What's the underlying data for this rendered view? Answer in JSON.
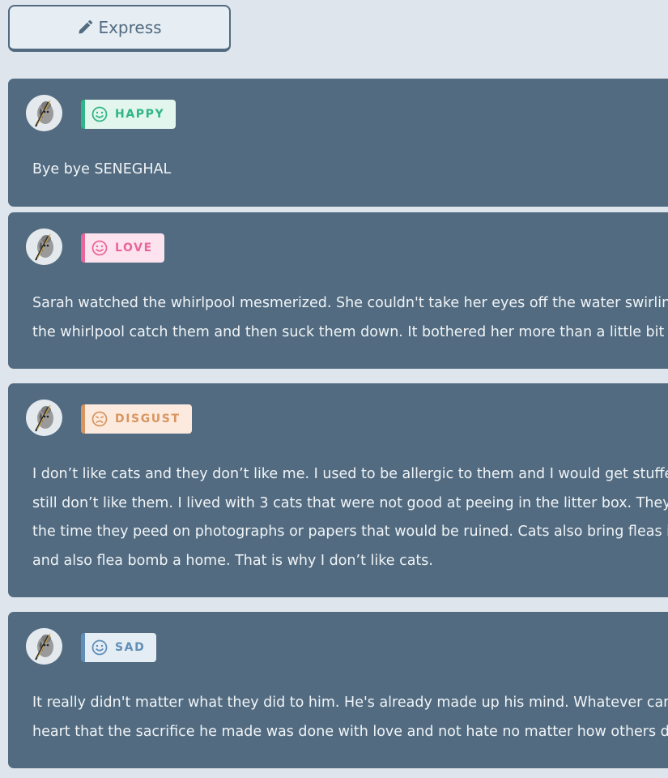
{
  "express_button": {
    "label": "Express",
    "icon": "pencil-icon"
  },
  "posts": [
    {
      "emotion": "HAPPY",
      "emotion_icon": "smile-icon",
      "colors": {
        "text": "#2fb586",
        "bg": "#e3f6ee",
        "accent": "#2fb586"
      },
      "lines": [
        "Bye bye SENEGHAL"
      ]
    },
    {
      "emotion": "LOVE",
      "emotion_icon": "smile-icon",
      "colors": {
        "text": "#e8679a",
        "bg": "#fde3ee",
        "accent": "#e8679a"
      },
      "lines": [
        "Sarah watched the whirlpool mesmerized. She couldn't take her eyes off the water swirling a",
        "the whirlpool catch them and then suck them down. It bothered her more than a little bit that"
      ]
    },
    {
      "emotion": "DISGUST",
      "emotion_icon": "frown-icon",
      "colors": {
        "text": "#d8955f",
        "bg": "#fdeadf",
        "accent": "#d8955f"
      },
      "lines": [
        "I don’t like cats and they don’t like me. I used to be allergic to them and I would get stuffed up",
        "still don’t like them. I lived with 3 cats that were not good at peeing in the litter box. They see",
        "the time they peed on photographs or papers that would be ruined. Cats also bring fleas into",
        "and also flea bomb a home. That is why I don’t like cats."
      ]
    },
    {
      "emotion": "SAD",
      "emotion_icon": "smile-icon",
      "colors": {
        "text": "#5f8fb8",
        "bg": "#e4ecf4",
        "accent": "#5f8fb8"
      },
      "lines": [
        "It really didn't matter what they did to him. He's already made up his mind. Whatever came hi",
        "heart that the sacrifice he made was done with love and not hate no matter how others decid"
      ]
    }
  ]
}
